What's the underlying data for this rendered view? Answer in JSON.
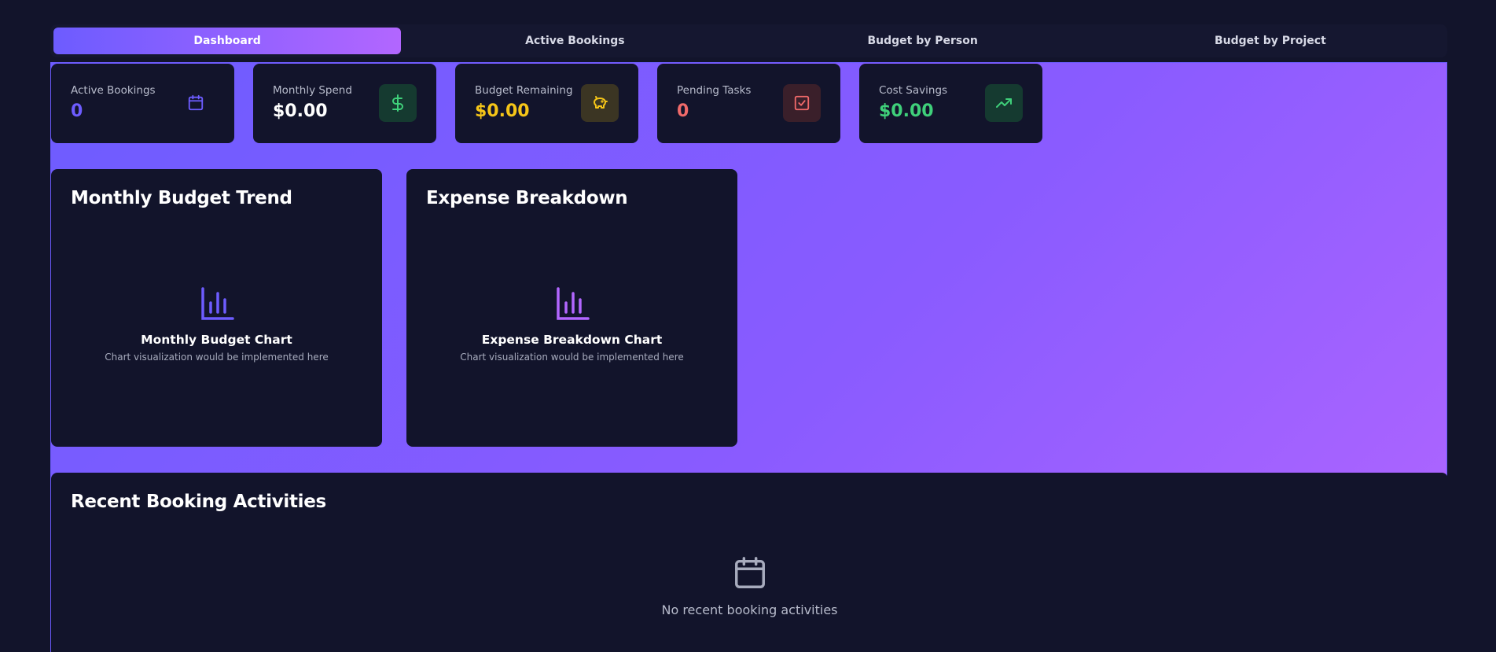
{
  "tabs": [
    {
      "label": "Dashboard",
      "active": true
    },
    {
      "label": "Active Bookings",
      "active": false
    },
    {
      "label": "Budget by Person",
      "active": false
    },
    {
      "label": "Budget by Project",
      "active": false
    }
  ],
  "stats": [
    {
      "label": "Active Bookings",
      "value": "0",
      "icon": "calendar-icon",
      "value_color": "#6d5cff"
    },
    {
      "label": "Monthly Spend",
      "value": "$0.00",
      "icon": "dollar-icon",
      "value_color": "#ffffff"
    },
    {
      "label": "Budget Remaining",
      "value": "$0.00",
      "icon": "piggy-bank-icon",
      "value_color": "#f5c518"
    },
    {
      "label": "Pending Tasks",
      "value": "0",
      "icon": "checkbox-icon",
      "value_color": "#f06a6a"
    },
    {
      "label": "Cost Savings",
      "value": "$0.00",
      "icon": "trending-up-icon",
      "value_color": "#3fd07a"
    }
  ],
  "charts": [
    {
      "title": "Monthly Budget Trend",
      "placeholder_title": "Monthly Budget Chart",
      "placeholder_subtitle": "Chart visualization would be implemented here",
      "icon_color": "#6d5cff"
    },
    {
      "title": "Expense Breakdown",
      "placeholder_title": "Expense Breakdown Chart",
      "placeholder_subtitle": "Chart visualization would be implemented here",
      "icon_color": "#b266ff"
    }
  ],
  "recent": {
    "title": "Recent Booking Activities",
    "empty_text": "No recent booking activities"
  },
  "colors": {
    "accent": "#6d5cff",
    "accent_end": "#b266ff",
    "background": "#12142b"
  }
}
